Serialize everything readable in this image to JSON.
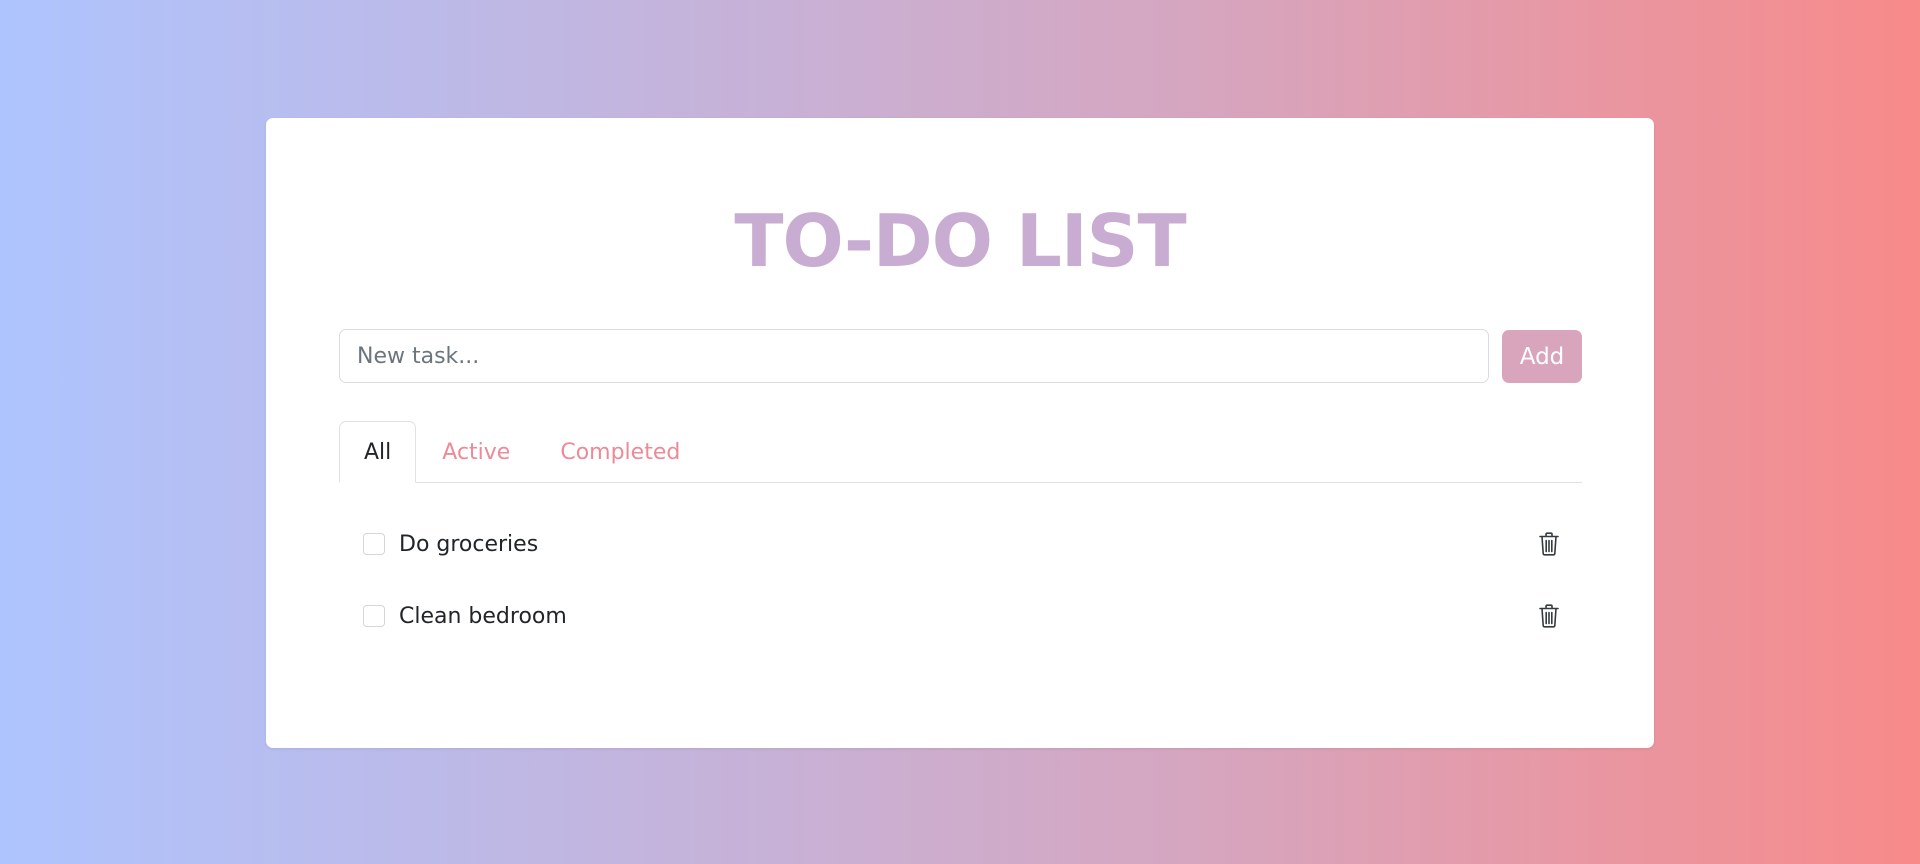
{
  "app": {
    "title": "TO-DO LIST"
  },
  "input": {
    "placeholder": "New task...",
    "value": ""
  },
  "add_button": {
    "label": "Add"
  },
  "tabs": [
    {
      "label": "All",
      "active": true
    },
    {
      "label": "Active",
      "active": false
    },
    {
      "label": "Completed",
      "active": false
    }
  ],
  "tasks": [
    {
      "text": "Do groceries",
      "completed": false,
      "delete_icon": "trash-icon"
    },
    {
      "text": "Clean bedroom",
      "completed": false,
      "delete_icon": "trash-icon"
    }
  ],
  "colors": {
    "title": "#c9acd2",
    "add_button": "#d9a5bd",
    "tab_inactive": "#ed8a98",
    "gradient_left": "#aec4fe",
    "gradient_right": "#f88a8a"
  }
}
